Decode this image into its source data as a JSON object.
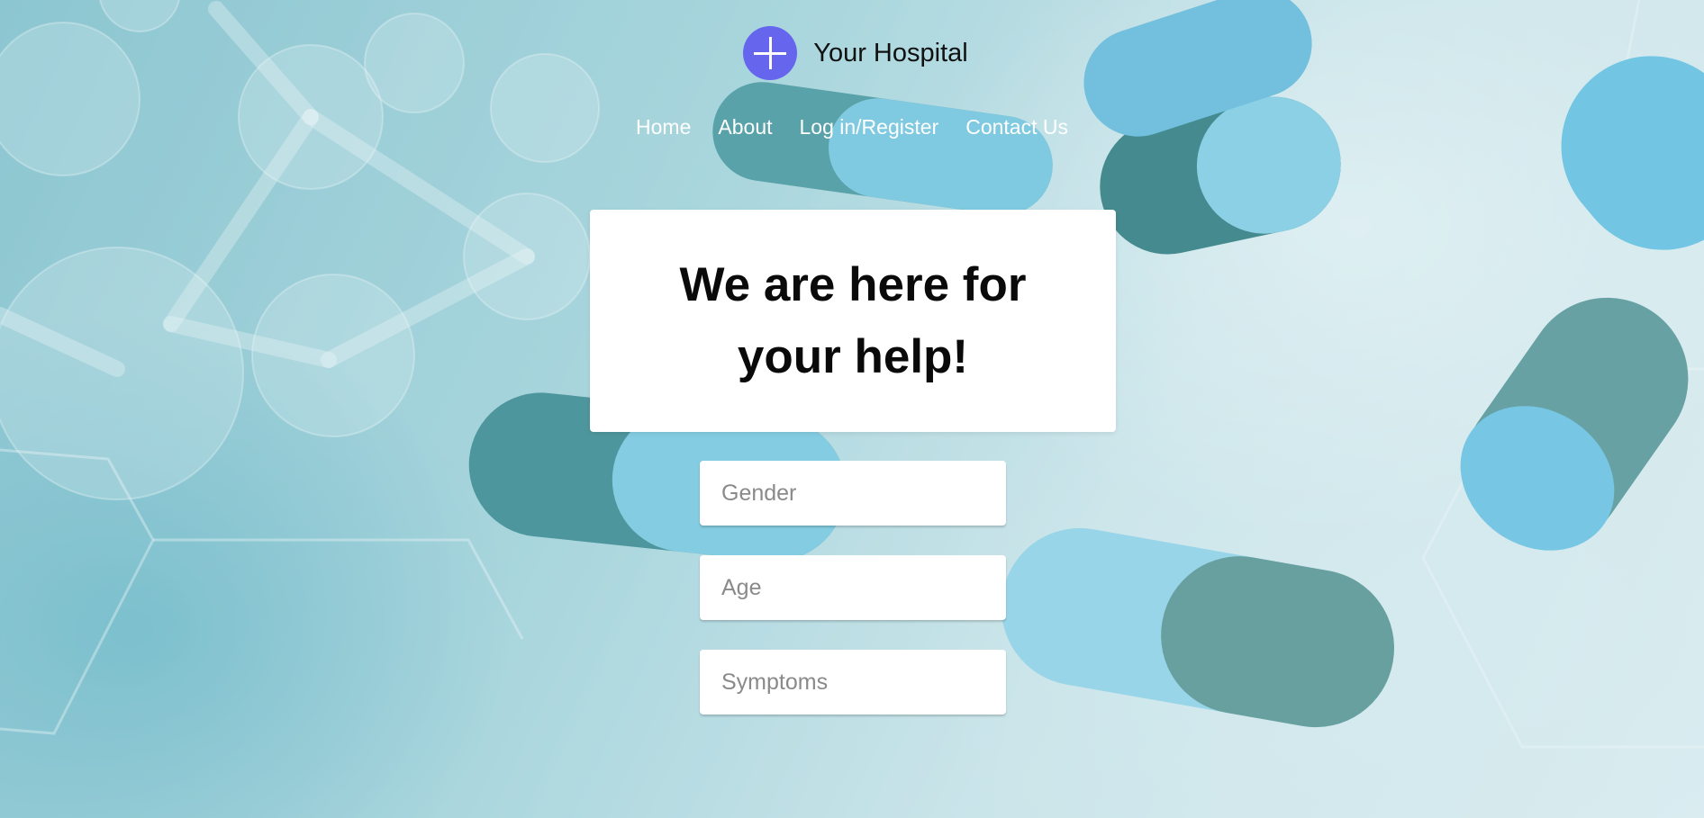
{
  "header": {
    "brand_name": "Your Hospital",
    "logo_icon": "plus-circle-icon",
    "logo_color": "#6565ee"
  },
  "nav": {
    "items": [
      {
        "label": "Home"
      },
      {
        "label": "About"
      },
      {
        "label": "Log in/Register"
      },
      {
        "label": "Contact Us"
      }
    ]
  },
  "hero": {
    "title": "We are here for your help!"
  },
  "form": {
    "gender": {
      "value": "",
      "placeholder": "Gender"
    },
    "age": {
      "value": "",
      "placeholder": "Age"
    },
    "symptoms": {
      "value": "",
      "placeholder": "Symptoms"
    }
  }
}
